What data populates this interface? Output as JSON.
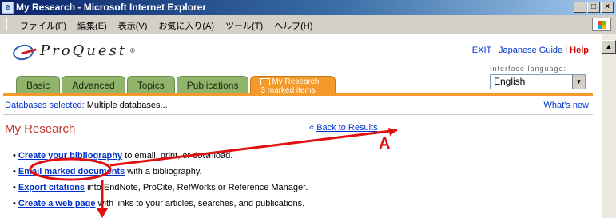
{
  "window": {
    "title": "My Research - Microsoft Internet Explorer",
    "controls": [
      "_",
      "□",
      "×"
    ]
  },
  "menu": {
    "items": [
      "ファイル(F)",
      "編集(E)",
      "表示(V)",
      "お気に入り(A)",
      "ツール(T)",
      "ヘルプ(H)"
    ]
  },
  "header": {
    "logo_text": "ProQuest",
    "links": {
      "exit": "EXIT",
      "sep1": "|",
      "japanese_guide": "Japanese Guide",
      "sep2": "|",
      "help": "Help"
    },
    "language": {
      "label": "Interface language:",
      "value": "English"
    }
  },
  "tabs": [
    {
      "label": "Basic"
    },
    {
      "label": "Advanced"
    },
    {
      "label": "Topics"
    },
    {
      "label": "Publications"
    },
    {
      "label": "My Research",
      "sub": "3 marked items"
    }
  ],
  "dbline": {
    "link": "Databases selected:",
    "text": " Multiple databases...",
    "whats_new": "What's new"
  },
  "main": {
    "heading": "My Research",
    "back_prefix": "« ",
    "back_link": "Back to Results",
    "items": [
      {
        "link": "Create your bibliography",
        "text": " to email, print, or download."
      },
      {
        "link": "Email marked documents",
        "text": " with a bibliography."
      },
      {
        "link": "Export citations",
        "text": " into EndNote, ProCite, RefWorks or Reference Manager."
      },
      {
        "link": "Create a web page",
        "text": " with links to your articles, searches, and publications."
      }
    ]
  },
  "annotation": {
    "label": "A",
    "color": "#e01010"
  }
}
